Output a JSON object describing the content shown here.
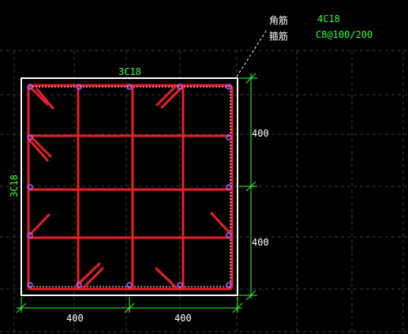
{
  "annotation": {
    "corner_label": "角筋",
    "corner_value": "4C18",
    "stirrup_label": "箍筋",
    "stirrup_value": "C8@100/200"
  },
  "top_rebar": "3C18",
  "side_rebar": "3C18",
  "dimensions": {
    "right_top": "400",
    "right_bottom": "400",
    "bottom_left": "400",
    "bottom_right": "400"
  },
  "colors": {
    "background": "#000000",
    "section": "#ffffff",
    "rebar": "#e8202a",
    "dimension": "#33ff33",
    "grid": "#3a3a3a"
  }
}
